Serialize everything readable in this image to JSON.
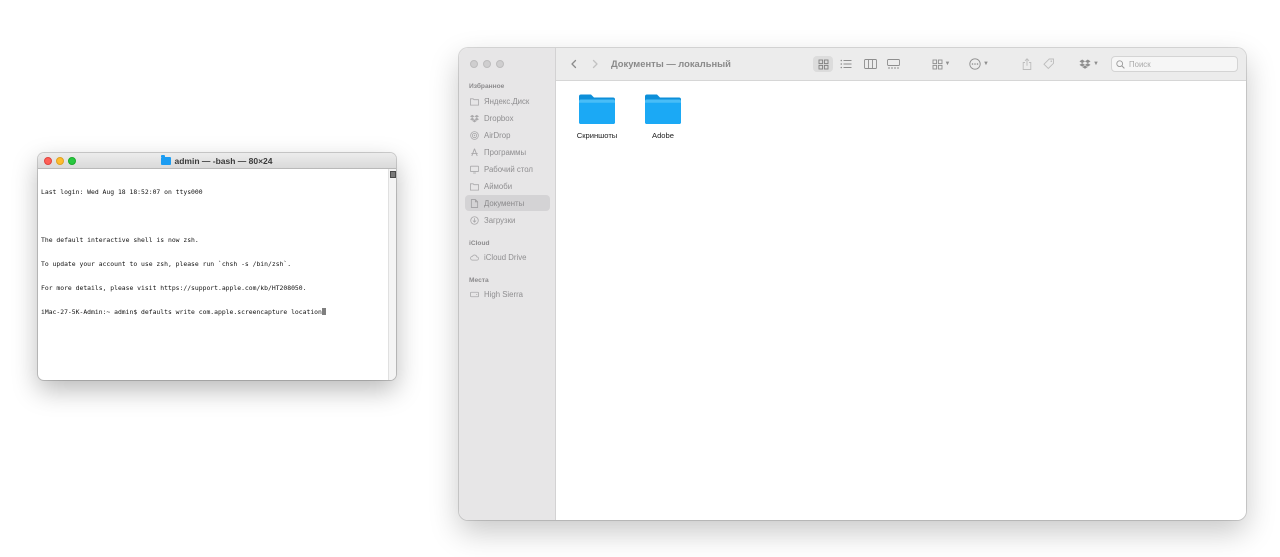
{
  "terminal": {
    "title": "admin — -bash — 80×24",
    "lines": [
      "Last login: Wed Aug 18 18:52:07 on ttys000",
      "",
      "The default interactive shell is now zsh.",
      "To update your account to use zsh, please run `chsh -s /bin/zsh`.",
      "For more details, please visit https://support.apple.com/kb/HT208050.",
      "iMac-27-5K-Admin:~ admin$ defaults write com.apple.screencapture location"
    ]
  },
  "finder": {
    "title": "Документы — локальный",
    "search_placeholder": "Поиск",
    "sidebar": {
      "sections": [
        {
          "label": "Избранное",
          "items": [
            {
              "label": "Яндекс.Диск",
              "icon": "folder-icon"
            },
            {
              "label": "Dropbox",
              "icon": "dropbox-icon"
            },
            {
              "label": "AirDrop",
              "icon": "airdrop-icon"
            },
            {
              "label": "Программы",
              "icon": "applications-icon"
            },
            {
              "label": "Рабочий стол",
              "icon": "desktop-icon"
            },
            {
              "label": "Аймоби",
              "icon": "folder-icon"
            },
            {
              "label": "Документы",
              "icon": "document-icon",
              "active": true
            },
            {
              "label": "Загрузки",
              "icon": "downloads-icon"
            }
          ]
        },
        {
          "label": "iCloud",
          "items": [
            {
              "label": "iCloud Drive",
              "icon": "cloud-icon"
            }
          ]
        },
        {
          "label": "Места",
          "items": [
            {
              "label": "High Sierra",
              "icon": "disk-icon"
            }
          ]
        }
      ]
    },
    "files": [
      {
        "name": "Скриншоты",
        "type": "folder"
      },
      {
        "name": "Adobe",
        "type": "folder"
      }
    ],
    "colors": {
      "folder": "#1ba9f5",
      "folder_dark": "#0d8fd9",
      "sidebar_bg": "#e7e6e7"
    }
  }
}
